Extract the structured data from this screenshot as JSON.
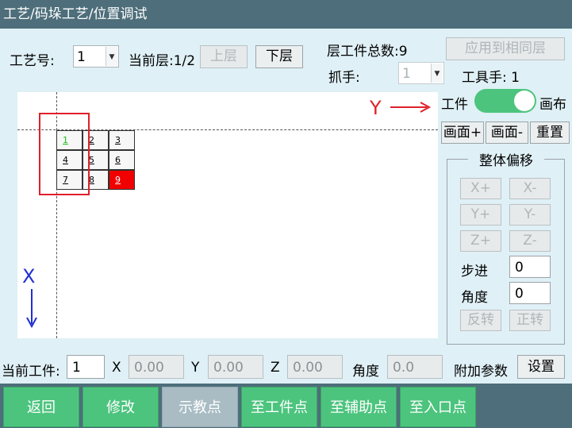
{
  "title": "工艺/码垛工艺/位置调试",
  "header": {
    "recipe_label": "工艺号:",
    "recipe_value": "1",
    "layer_label": "当前层:1/2",
    "up_layer": "上层",
    "down_layer": "下层",
    "layer_count": "层工件总数:9",
    "apply_same_layer": "应用到相同层",
    "gripper_label": "抓手:",
    "gripper_value": "1",
    "tool_hand": "工具手: 1"
  },
  "canvas": {
    "y_axis_label": "Y",
    "x_axis_label": "X",
    "cells": [
      {
        "label": "1",
        "state": "highlight"
      },
      {
        "label": "2",
        "state": "normal"
      },
      {
        "label": "3",
        "state": "normal"
      },
      {
        "label": "4",
        "state": "normal"
      },
      {
        "label": "5",
        "state": "normal"
      },
      {
        "label": "6",
        "state": "normal"
      },
      {
        "label": "7",
        "state": "normal"
      },
      {
        "label": "8",
        "state": "normal"
      },
      {
        "label": "9",
        "state": "current"
      }
    ]
  },
  "right_panel": {
    "toggle_left": "工件",
    "toggle_right": "画布",
    "toggle_state": "on",
    "canvas_plus": "画面+",
    "canvas_minus": "画面-",
    "reset": "重置",
    "offset_title": "整体偏移",
    "x_plus": "X+",
    "x_minus": "X-",
    "y_plus": "Y+",
    "y_minus": "Y-",
    "z_plus": "Z+",
    "z_minus": "Z-",
    "step_label": "步进",
    "step_value": "0",
    "angle_label": "角度",
    "angle_value": "0",
    "reverse": "反转",
    "forward": "正转"
  },
  "position_row": {
    "current_label": "当前工件:",
    "current_value": "1",
    "x_label": "X",
    "x_value": "0.00",
    "y_label": "Y",
    "y_value": "0.00",
    "z_label": "Z",
    "z_value": "0.00",
    "angle_label": "角度",
    "angle_value": "0.0",
    "extra_label": "附加参数",
    "settings": "设置"
  },
  "nav": {
    "back": "返回",
    "modify": "修改",
    "teach": "示教点",
    "to_work": "至工件点",
    "to_aux": "至辅助点",
    "to_entry": "至入口点"
  },
  "colors": {
    "title_bar": "#4d6e7a",
    "nav_green": "#4cc47e",
    "nav_active": "#a9bcc4",
    "current_cell": "#f00000",
    "highlight_text": "#18c018",
    "y_axis": "#e0202a",
    "x_axis": "#2030d0"
  }
}
